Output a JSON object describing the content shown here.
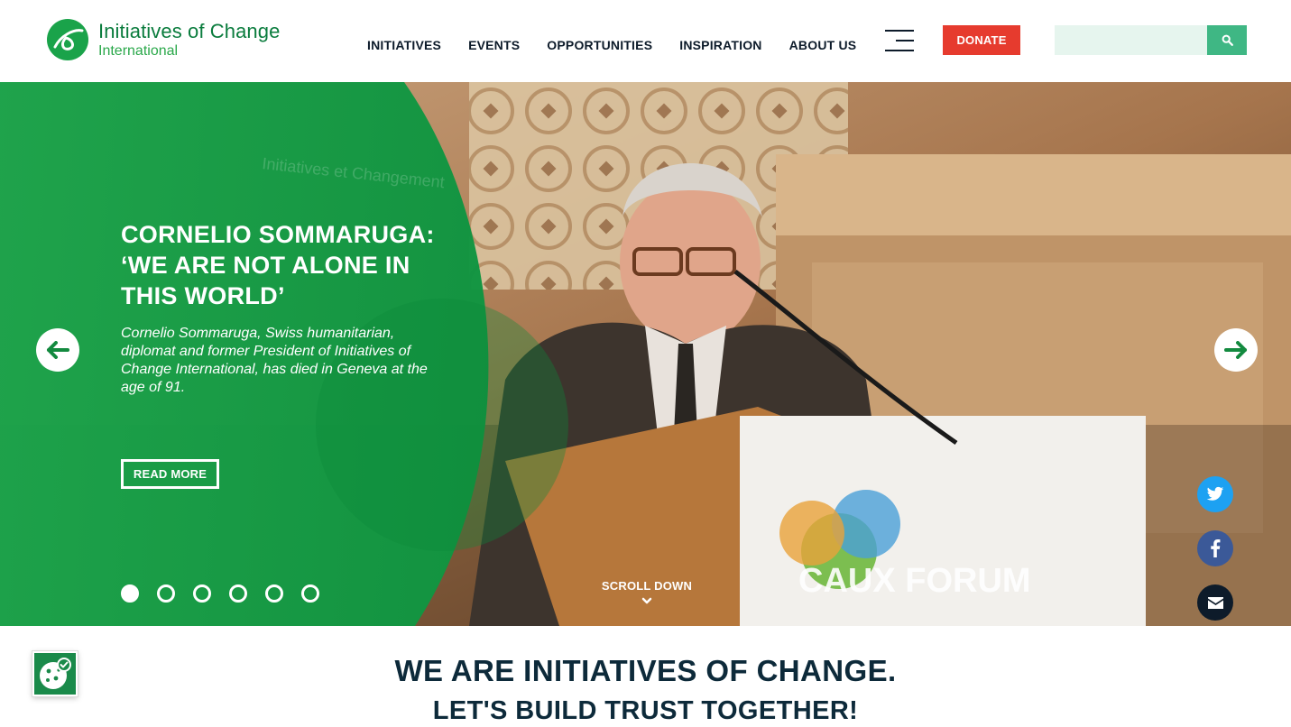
{
  "header": {
    "logo_title": "Initiatives of Change",
    "logo_subtitle": "International",
    "nav": [
      "INITIATIVES",
      "EVENTS",
      "OPPORTUNITIES",
      "INSPIRATION",
      "ABOUT US"
    ],
    "donate_label": "DONATE",
    "search_placeholder": ""
  },
  "hero": {
    "title": "CORNELIO SOMMARUGA: ‘WE ARE NOT ALONE IN THIS WORLD’",
    "description": "Cornelio Sommaruga, Swiss humanitarian, diplomat and former President of Initiatives of Change International, has died in Geneva at the age of 91.",
    "read_more_label": "READ MORE",
    "scroll_label": "SCROLL DOWN",
    "slide_count": 6,
    "active_slide": 1,
    "photo_caption_texts": [
      "Initiatives et Changement",
      "CAUX FORUM"
    ]
  },
  "social": [
    "twitter-icon",
    "facebook-icon",
    "email-icon"
  ],
  "intro": {
    "headline": "WE ARE INITIATIVES OF CHANGE.",
    "subheadline": "LET'S BUILD TRUST TOGETHER!"
  },
  "colors": {
    "brand_green": "#0a7c3d",
    "hero_green": "#14a044",
    "donate_red": "#e63b2e",
    "search_green": "#3fb784",
    "navy": "#0d1b2a"
  }
}
